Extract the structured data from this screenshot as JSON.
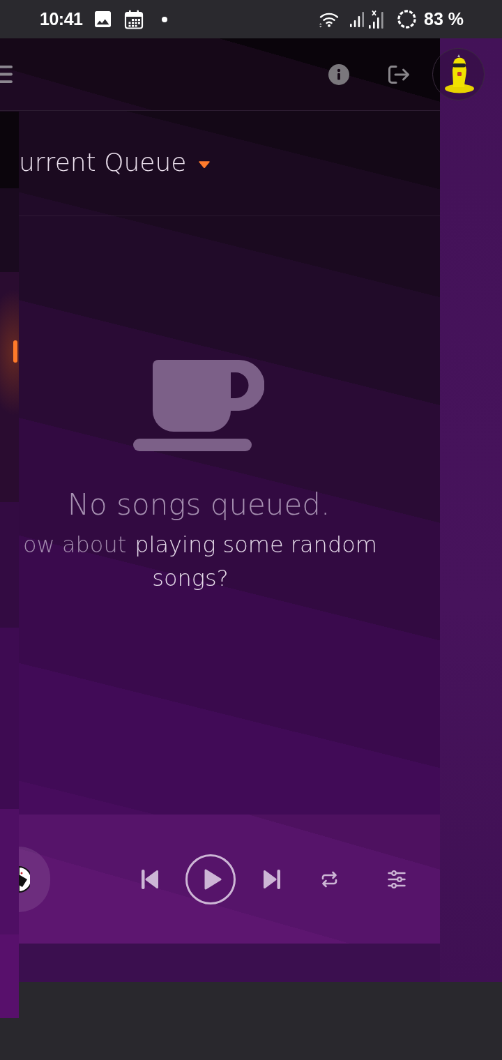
{
  "status_bar": {
    "time": "10:41",
    "battery": "83 %"
  },
  "queue": {
    "title": "urrent Queue"
  },
  "empty_state": {
    "message": "No songs queued.",
    "hint": "ow about",
    "link": "playing some random songs?"
  },
  "player": {
    "playing": false
  }
}
